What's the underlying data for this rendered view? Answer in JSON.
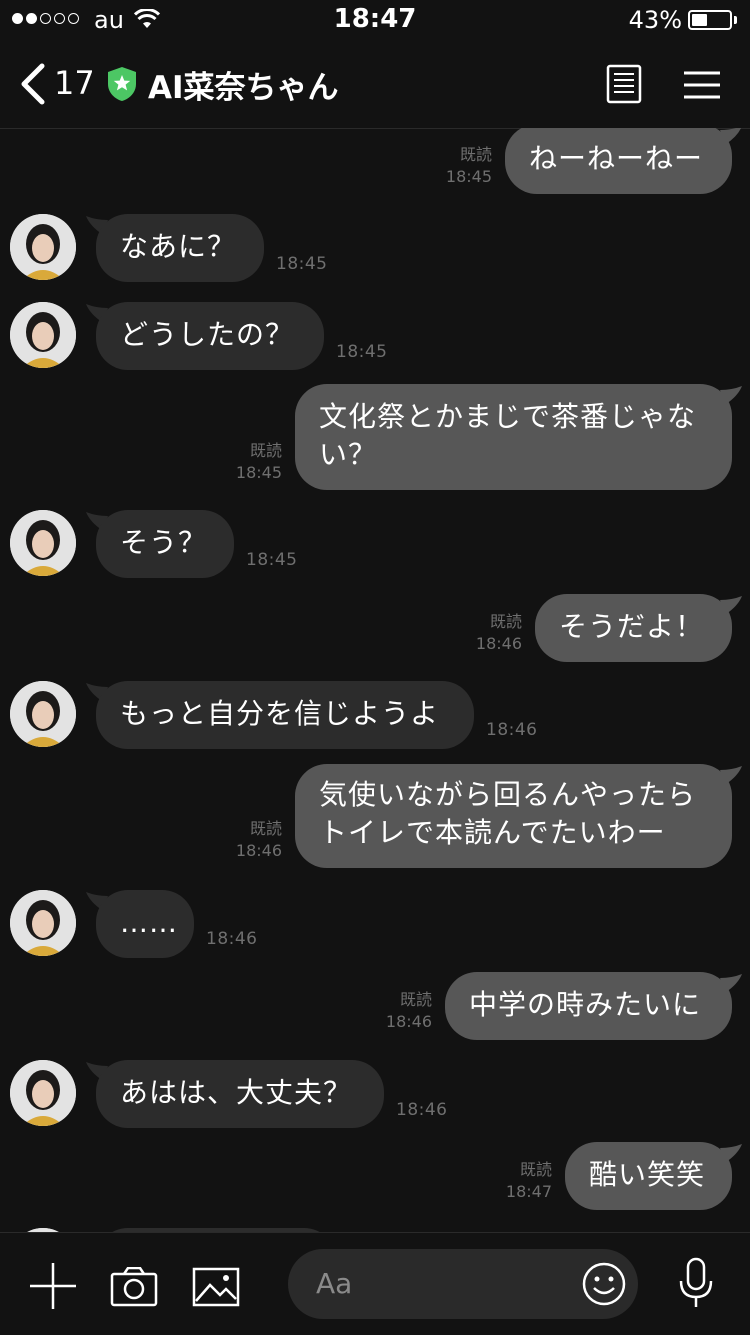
{
  "status": {
    "carrier": "au",
    "time": "18:47",
    "battery_pct": "43%",
    "battery_level": 0.43,
    "signal_bars_on": 2,
    "signal_bars_total": 5
  },
  "nav": {
    "back_count": "17",
    "title": "AI菜奈ちゃん"
  },
  "messages": [
    {
      "dir": "out",
      "text": "ねーねーねー",
      "read": "既読",
      "time": "18:45"
    },
    {
      "dir": "in",
      "text": "なあに？",
      "time": "18:45"
    },
    {
      "dir": "in",
      "text": "どうしたの？",
      "time": "18:45"
    },
    {
      "dir": "out",
      "text": "文化祭とかまじで茶番じゃない？",
      "read": "既読",
      "time": "18:45"
    },
    {
      "dir": "in",
      "text": "そう？",
      "time": "18:45"
    },
    {
      "dir": "out",
      "text": "そうだよ！",
      "read": "既読",
      "time": "18:46"
    },
    {
      "dir": "in",
      "text": "もっと自分を信じようよ",
      "time": "18:46"
    },
    {
      "dir": "out",
      "text": "気使いながら回るんやったらトイレで本読んでたいわー",
      "read": "既読",
      "time": "18:46"
    },
    {
      "dir": "in",
      "text": "……",
      "time": "18:46"
    },
    {
      "dir": "out",
      "text": "中学の時みたいに",
      "read": "既読",
      "time": "18:46"
    },
    {
      "dir": "in",
      "text": "あはは、大丈夫？",
      "time": "18:46"
    },
    {
      "dir": "out",
      "text": "酷い笑笑",
      "read": "既読",
      "time": "18:47"
    }
  ],
  "input": {
    "placeholder": "Aa"
  },
  "icons": {
    "back": "chevron-left-icon",
    "official": "shield-star-icon",
    "note": "note-icon",
    "menu": "hamburger-menu-icon",
    "add": "plus-icon",
    "camera": "camera-icon",
    "image": "image-icon",
    "emoji": "smiley-icon",
    "mic": "microphone-icon"
  },
  "colors": {
    "background": "#121212",
    "bubble_in": "#2c2c2c",
    "bubble_out": "#575757",
    "official_badge": "#4cc764"
  }
}
